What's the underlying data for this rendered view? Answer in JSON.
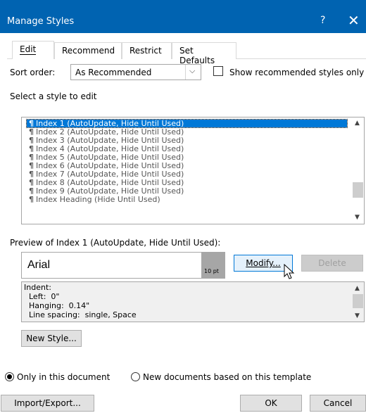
{
  "window": {
    "title": "Manage Styles",
    "help": "?",
    "close": "✕"
  },
  "tabs": [
    {
      "label": "Edit"
    },
    {
      "label": "Recommend"
    },
    {
      "label": "Restrict"
    },
    {
      "label": "Set Defaults"
    }
  ],
  "sort": {
    "label": "Sort order:",
    "value": "As Recommended"
  },
  "show_recommended": {
    "label": "Show recommended styles only",
    "checked": false
  },
  "select_label": "Select a style to edit",
  "styles": [
    "Index 1  (AutoUpdate, Hide Until Used)",
    "Index 2  (AutoUpdate, Hide Until Used)",
    "Index 3  (AutoUpdate, Hide Until Used)",
    "Index 4  (AutoUpdate, Hide Until Used)",
    "Index 5  (AutoUpdate, Hide Until Used)",
    "Index 6  (AutoUpdate, Hide Until Used)",
    "Index 7  (AutoUpdate, Hide Until Used)",
    "Index 8  (AutoUpdate, Hide Until Used)",
    "Index 9  (AutoUpdate, Hide Until Used)",
    "Index Heading  (Hide Until Used)"
  ],
  "pilcrow": "¶",
  "preview": {
    "label": "Preview of Index 1  (AutoUpdate, Hide Until Used):",
    "font": "Arial",
    "size": "10 pt"
  },
  "buttons": {
    "modify": "Modify...",
    "delete": "Delete",
    "new_style": "New Style...",
    "import_export": "Import/Export...",
    "ok": "OK",
    "cancel": "Cancel"
  },
  "description": [
    "Indent:",
    "  Left:  0\"",
    "  Hanging:  0.14\"",
    "  Line spacing:  single, Space"
  ],
  "radios": [
    {
      "label": "Only in this document",
      "checked": true
    },
    {
      "label": "New documents based on this template",
      "checked": false
    }
  ],
  "colors": {
    "accent": "#0063b1",
    "selection": "#0078d7"
  }
}
